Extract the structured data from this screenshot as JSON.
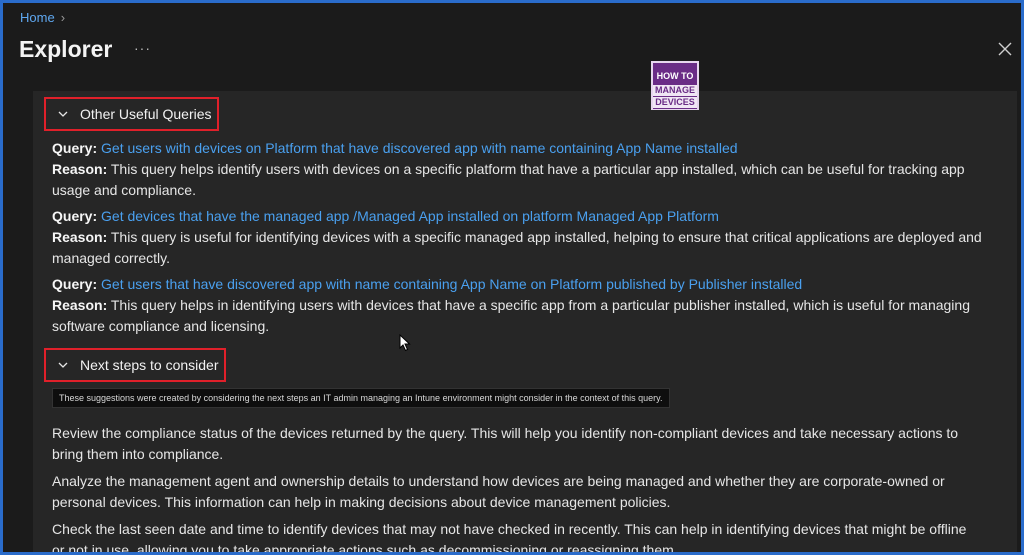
{
  "header": {
    "breadcrumb_home": "Home",
    "title": "Explorer",
    "more": "···"
  },
  "logo": {
    "line1": "HOW TO",
    "line2": "MANAGE",
    "line3": "DEVICES"
  },
  "sections": {
    "useful_queries": {
      "label": "Other Useful Queries",
      "items": [
        {
          "query_prefix": "Query:",
          "query_link": "Get users with devices on Platform that have discovered app with name containing App Name installed",
          "reason_prefix": "Reason:",
          "reason_line1": "This query helps identify users with devices on a specific platform that have a particular app installed, which can be useful for tracking app",
          "reason_line2": "usage and compliance."
        },
        {
          "query_prefix": "Query:",
          "query_link": "Get devices that have the managed app /Managed App installed on platform Managed App Platform",
          "reason_prefix": "Reason:",
          "reason_line1": "This query is useful for identifying devices with a specific managed app installed, helping to ensure that critical applications are deployed and",
          "reason_line2": "managed correctly."
        },
        {
          "query_prefix": "Query:",
          "query_link": "Get users that have discovered app with name containing App Name on Platform published by Publisher installed",
          "reason_prefix": "Reason:",
          "reason_line1": "This query helps in identifying users with devices that have a specific app from a particular publisher installed, which is useful for managing",
          "reason_line2": "software compliance and licensing."
        }
      ]
    },
    "next_steps": {
      "label": "Next steps to consider",
      "note": "These suggestions were created by considering the next steps an IT admin managing an Intune environment might consider in the context of this query.",
      "paragraphs": [
        {
          "line1": "Review the compliance status of the devices returned by the query. This will help you identify non-compliant devices and take necessary actions to",
          "line2": "bring them into compliance."
        },
        {
          "line1": "Analyze the management agent and ownership details to understand how devices are being managed and whether they are corporate-owned or",
          "line2": "personal devices. This information can help in making decisions about device management policies."
        },
        {
          "line1": "Check the last seen date and time to identify devices that may not have checked in recently. This can help in identifying devices that might be offline",
          "line2": "or not in use, allowing you to take appropriate actions such as decommissioning or reassigning them."
        }
      ]
    }
  },
  "colors": {
    "accent_link": "#4aa0ef",
    "highlight_border": "#e0202a",
    "frame_border": "#2a6ccb"
  }
}
